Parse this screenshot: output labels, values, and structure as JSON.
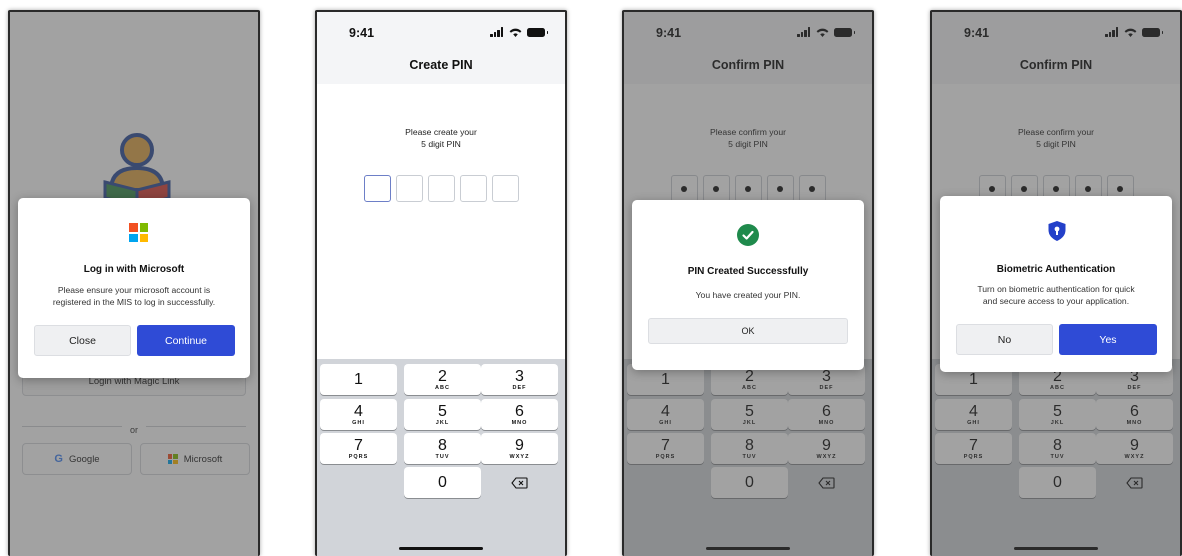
{
  "status": {
    "time": "9:41"
  },
  "login": {
    "magic_link_label": "Login with Magic Link",
    "or_label": "or",
    "google_label": "Google",
    "google_glyph": "G",
    "microsoft_label": "Microsoft",
    "dialog": {
      "title": "Log in with Microsoft",
      "body_line1": "Please ensure your microsoft account is",
      "body_line2": "registered in the MIS to log in successfully.",
      "close_label": "Close",
      "continue_label": "Continue"
    }
  },
  "create_pin": {
    "title": "Create PIN",
    "prompt_line1": "Please create your",
    "prompt_line2": "5 digit PIN"
  },
  "confirm_pin": {
    "title": "Confirm PIN",
    "prompt_line1": "Please confirm your",
    "prompt_line2": "5 digit PIN",
    "success_dialog": {
      "title": "PIN Created Successfully",
      "body": "You have created your PIN.",
      "ok_label": "OK"
    },
    "biometric_dialog": {
      "title": "Biometric Authentication",
      "body_line1": "Turn on biometric authentication for quick",
      "body_line2": "and secure access to your application.",
      "no_label": "No",
      "yes_label": "Yes"
    }
  },
  "keypad": {
    "keys": [
      {
        "n": "1",
        "l": ""
      },
      {
        "n": "2",
        "l": "ABC"
      },
      {
        "n": "3",
        "l": "DEF"
      },
      {
        "n": "4",
        "l": "GHI"
      },
      {
        "n": "5",
        "l": "JKL"
      },
      {
        "n": "6",
        "l": "MNO"
      },
      {
        "n": "7",
        "l": "PQRS"
      },
      {
        "n": "8",
        "l": "TUV"
      },
      {
        "n": "9",
        "l": "WXYZ"
      },
      {
        "n": "0",
        "l": ""
      }
    ]
  },
  "colors": {
    "primary": "#2f4bd6",
    "success": "#1f8a4c",
    "shield": "#2340c9",
    "ms_red": "#f25022",
    "ms_green": "#7fba00",
    "ms_blue": "#00a4ef",
    "ms_yellow": "#ffb900"
  },
  "icons": {
    "logo": "reader-logo-icon",
    "microsoft": "microsoft-logo-icon",
    "success": "check-circle-icon",
    "biometric": "shield-key-icon",
    "backspace": "backspace-icon"
  }
}
